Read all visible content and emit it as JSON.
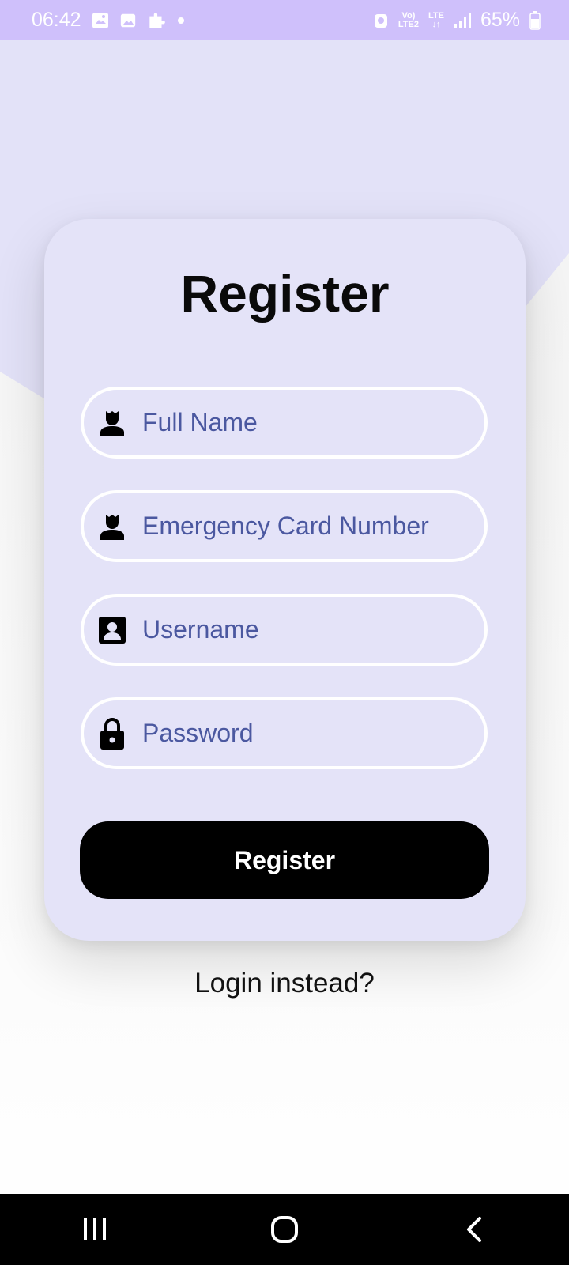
{
  "status_bar": {
    "time": "06:42",
    "network_top": "Vo)",
    "network_bottom": "LTE2",
    "lte_label": "LTE",
    "battery_percent": "65%",
    "notification_icons": [
      "sync-image-icon",
      "gallery-icon",
      "puzzle-icon",
      "dot-icon"
    ],
    "system_icons": [
      "alarm-icon",
      "volte-icon",
      "lte-icon",
      "signal-icon",
      "battery-icon"
    ]
  },
  "colors": {
    "status_bar_bg": "#cfc0fb",
    "page_bg_top": "#e3e2f8",
    "card_bg": "#e4e3f8",
    "field_border": "#ffffff",
    "placeholder_text": "#4b58a0",
    "button_bg": "#000000",
    "button_text": "#ffffff"
  },
  "form": {
    "title": "Register",
    "fields": [
      {
        "icon": "person-icon",
        "placeholder": "Full Name",
        "value": ""
      },
      {
        "icon": "person-icon",
        "placeholder": "Emergency Card Number",
        "value": ""
      },
      {
        "icon": "account-box-icon",
        "placeholder": "Username",
        "value": ""
      },
      {
        "icon": "lock-icon",
        "placeholder": "Password",
        "value": ""
      }
    ],
    "submit_label": "Register",
    "login_link": "Login instead?"
  },
  "nav_bar": {
    "buttons": [
      "recent-apps-icon",
      "home-icon",
      "back-icon"
    ]
  }
}
